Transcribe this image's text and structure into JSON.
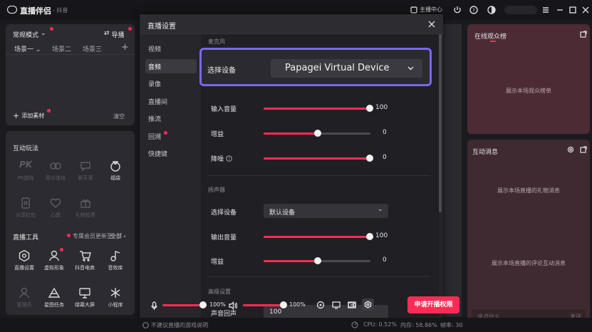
{
  "titlebar": {
    "app_name": "直播伴侣",
    "app_sub": "- 抖音",
    "host_center": "主播中心"
  },
  "scene_panel": {
    "mode": "常规模式",
    "import_label": "导播",
    "scenes": [
      "场景一",
      "场景二",
      "场景三"
    ],
    "add_material": "添加素材",
    "clear": "清空"
  },
  "interactive": {
    "title": "互动玩法",
    "tools": [
      "PK连线",
      "观众连线",
      "聊天室",
      "福袋",
      "分享红包",
      "心愿",
      "礼物投票"
    ],
    "live_tools_title": "直播工具",
    "member_notice": "专属会员更新至",
    "all_label": "全部",
    "live_tools": [
      "直播设置",
      "虚拟形象",
      "抖音电商",
      "音效库",
      "管理员",
      "星图任务",
      "绿幕大屏",
      "小程序"
    ]
  },
  "modal": {
    "title": "直播设置",
    "nav": [
      "视频",
      "音频",
      "录像",
      "直播间",
      "推流",
      "回溯",
      "快捷键"
    ],
    "active_nav": "音频",
    "mic_section": "麦克风",
    "select_device_label": "选择设备",
    "select_device_value": "Papagei Virtual Device",
    "input_volume_label": "输入音量",
    "input_volume": 100,
    "gain_label": "增益",
    "gain": 0,
    "noise_label": "降噪",
    "noise": 0,
    "speaker_section": "扬声器",
    "speaker_device_label": "选择设备",
    "speaker_device_value": "默认设备",
    "output_volume_label": "输出音量",
    "output_volume": 100,
    "speaker_gain_label": "增益",
    "speaker_gain": 0,
    "advanced_section": "高级设置",
    "advanced_row_label": "声音回声",
    "advanced_row_value": "100"
  },
  "bottombar": {
    "mic_volume": "100%",
    "speaker_volume": "100%",
    "apply_button": "申请开播权限"
  },
  "right": {
    "viewer_title": "在线观众榜",
    "viewer_empty": "展示本场观众榜单",
    "msg_title": "互动消息",
    "gift_empty": "展示本场直播的礼物消息",
    "comment_empty": "展示本场直播的评论互动消息",
    "input_placeholder": "说点什么...",
    "send": "发送"
  },
  "statusbar": {
    "hint": "不建议直播的游戏说明",
    "cpu": "CPU: 0.52%",
    "mem": "内存: 58.86%",
    "fps": "帧率: 30"
  },
  "colors": {
    "accent": "#fe2c55",
    "highlight": "#7868f0"
  }
}
